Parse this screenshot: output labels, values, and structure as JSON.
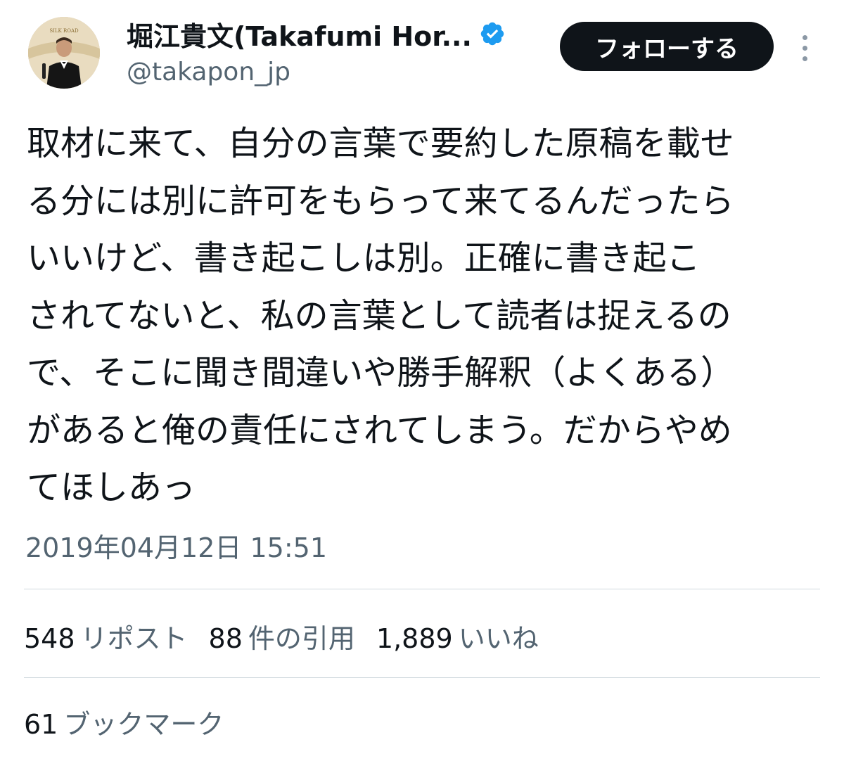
{
  "author": {
    "display_name": "堀江貴文(Takafumi Hor...",
    "handle": "@takapon_jp",
    "verified": true,
    "avatar_icon": "profile-photo"
  },
  "header": {
    "follow_label": "フォローする",
    "more_icon": "more-vertical-icon"
  },
  "tweet": {
    "text": "取材に来て、自分の言葉で要約した原稿を載せ\nる分には別に許可をもらって来てるんだったら\nいいけど、書き起こしは別。正確に書き起こ\nされてないと、私の言葉として読者は捉えるの\nで、そこに聞き間違いや勝手解釈（よくある）\nがあると俺の責任にされてしまう。だからやめ\nてほしあっ",
    "timestamp": "2019年04月12日 15:51"
  },
  "stats": {
    "reposts": {
      "count": "548",
      "label": "リポスト"
    },
    "quotes": {
      "count": "88",
      "label": "件の引用"
    },
    "likes": {
      "count": "1,889",
      "label": "いいね"
    },
    "bookmarks": {
      "count": "61",
      "label": "ブックマーク"
    }
  },
  "colors": {
    "text_primary": "#0f1419",
    "text_secondary": "#536471",
    "divider": "#cfd9de",
    "verified_blue": "#1d9bf0",
    "follow_button_bg": "#0f1419"
  }
}
